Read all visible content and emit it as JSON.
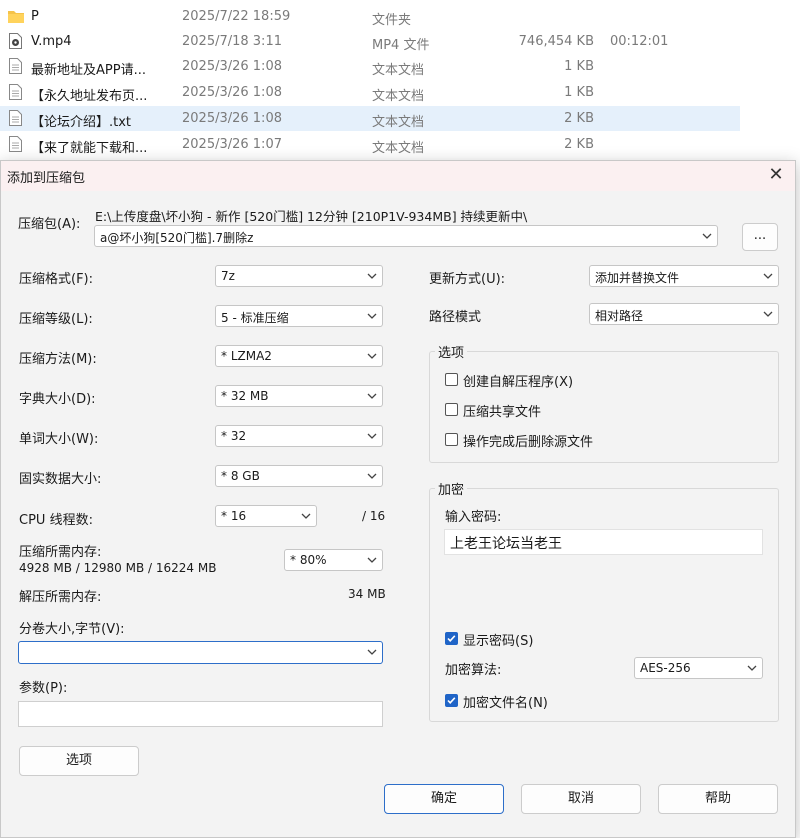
{
  "files": [
    {
      "name": "P",
      "date": "2025/7/22 18:59",
      "type": "文件夹",
      "size": "",
      "duration": "",
      "icon": "folder-icon"
    },
    {
      "name": "V.mp4",
      "date": "2025/7/18 3:11",
      "type": "MP4 文件",
      "size": "746,454 KB",
      "duration": "00:12:01",
      "icon": "video-file-icon"
    },
    {
      "name": "最新地址及APP请...",
      "date": "2025/3/26 1:08",
      "type": "文本文档",
      "size": "1 KB",
      "duration": "",
      "icon": "text-file-icon"
    },
    {
      "name": "【永久地址发布页...",
      "date": "2025/3/26 1:08",
      "type": "文本文档",
      "size": "1 KB",
      "duration": "",
      "icon": "text-file-icon"
    },
    {
      "name": "【论坛介绍】.txt",
      "date": "2025/3/26 1:08",
      "type": "文本文档",
      "size": "2 KB",
      "duration": "",
      "icon": "text-file-icon"
    },
    {
      "name": "【来了就能下载和...",
      "date": "2025/3/26 1:07",
      "type": "文本文档",
      "size": "2 KB",
      "duration": "",
      "icon": "text-file-icon"
    }
  ],
  "dialog": {
    "title": "添加到压缩包",
    "archive_label": "压缩包(A):",
    "archive_path": "E:\\上传度盘\\坏小狗 - 新作 [520门槛] 12分钟 [210P1V-934MB] 持续更新中\\",
    "archive_name": "a@坏小狗[520门槛].7删除z",
    "browse_label": "...",
    "format_label": "压缩格式(F):",
    "format_value": "7z",
    "level_label": "压缩等级(L):",
    "level_value": "5 - 标准压缩",
    "method_label": "压缩方法(M):",
    "method_value": "* LZMA2",
    "dict_label": "字典大小(D):",
    "dict_value": "* 32 MB",
    "word_label": "单词大小(W):",
    "word_value": "* 32",
    "solid_label": "固实数据大小:",
    "solid_value": "* 8 GB",
    "cpu_label": "CPU 线程数:",
    "cpu_value": "* 16",
    "cpu_total": "/ 16",
    "mem_label": "压缩所需内存:",
    "mem_detail": "4928 MB / 12980 MB / 16224 MB",
    "mem_value": "* 80%",
    "decomp_label": "解压所需内存:",
    "decomp_value": "34 MB",
    "split_label": "分卷大小,字节(V):",
    "split_value": "",
    "params_label": "参数(P):",
    "params_value": "",
    "options_button": "选项",
    "update_label": "更新方式(U):",
    "update_value": "添加并替换文件",
    "path_label": "路径模式",
    "path_value": "相对路径",
    "options_group": "选项",
    "opt_sfx": "创建自解压程序(X)",
    "opt_shared": "压缩共享文件",
    "opt_delete": "操作完成后删除源文件",
    "enc_group": "加密",
    "enc_pwd_label": "输入密码:",
    "enc_pwd_value": "上老王论坛当老王",
    "show_pwd": "显示密码(S)",
    "enc_method_label": "加密算法:",
    "enc_method_value": "AES-256",
    "enc_names": "加密文件名(N)",
    "ok": "确定",
    "cancel": "取消",
    "help": "帮助"
  }
}
